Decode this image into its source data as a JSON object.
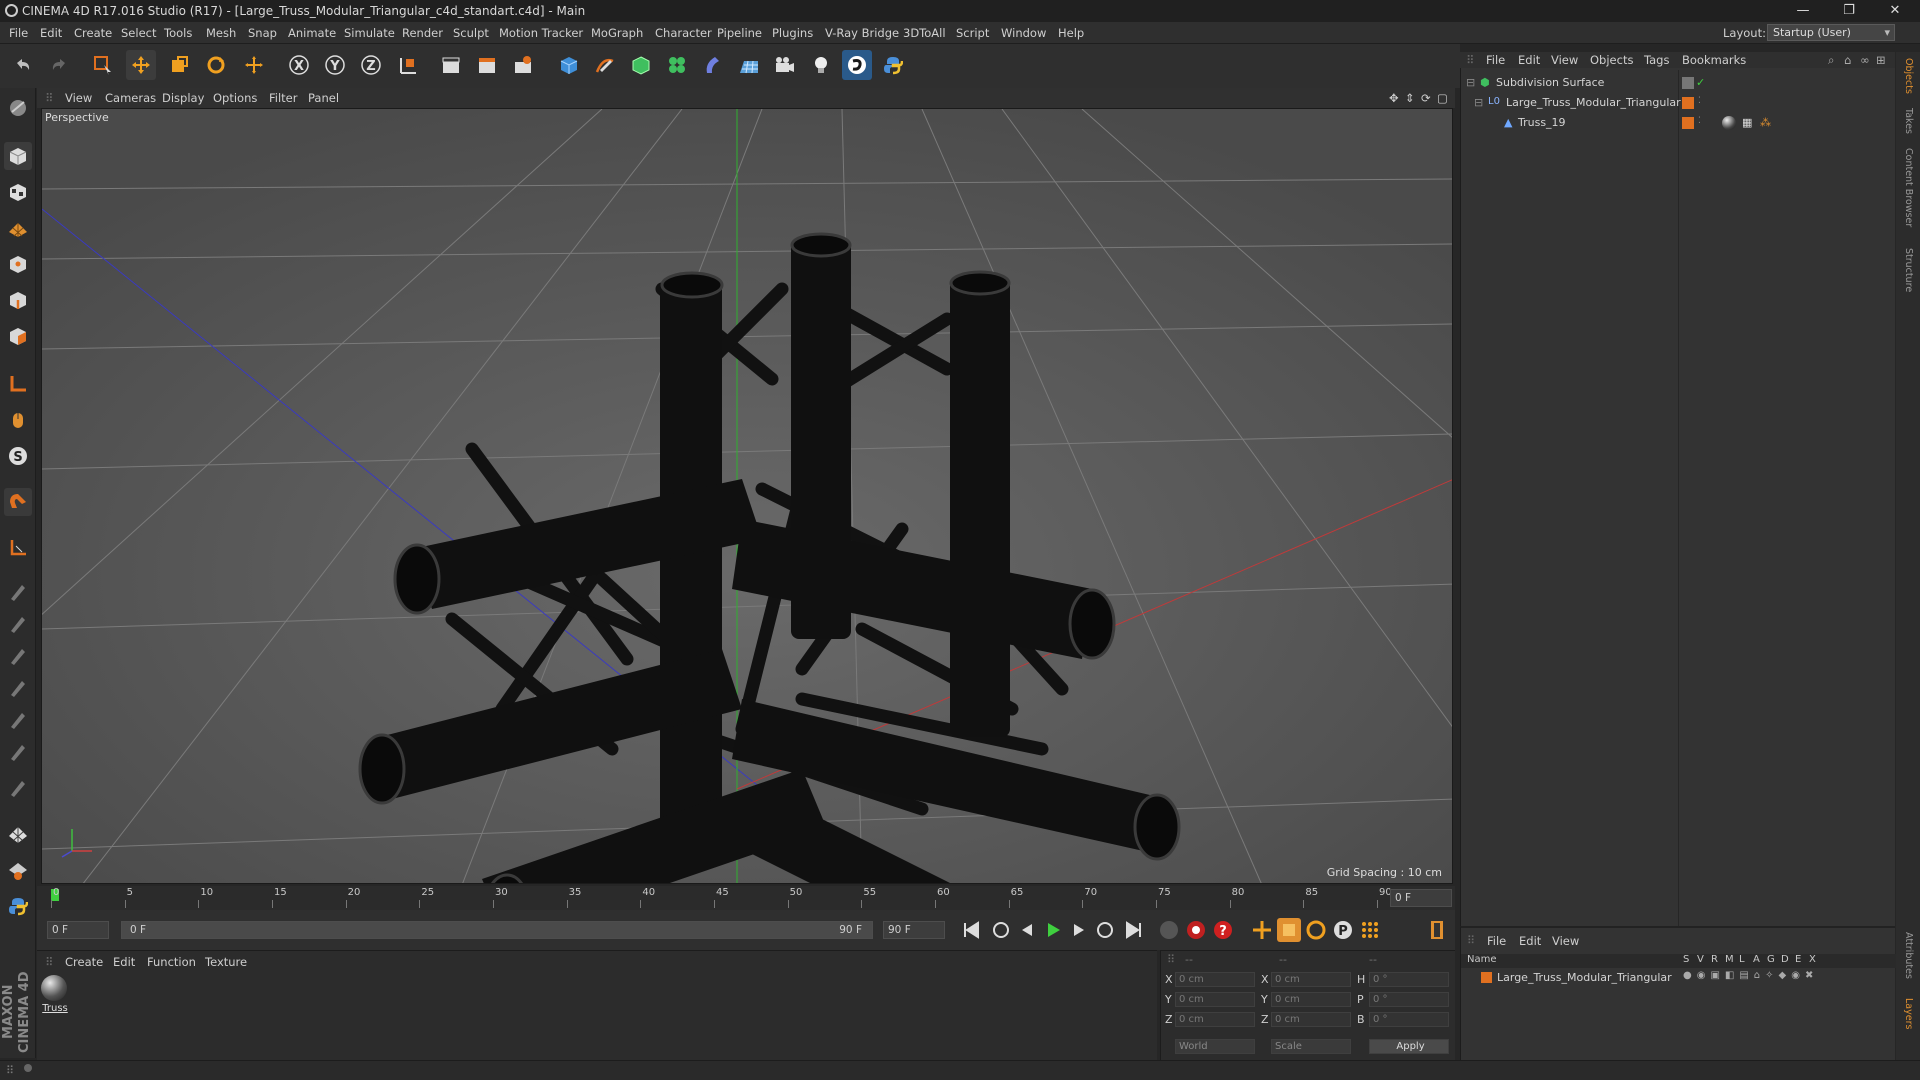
{
  "title_bar": {
    "title": "CINEMA 4D R17.016 Studio (R17) - [Large_Truss_Modular_Triangular_c4d_standart.c4d] - Main",
    "minimize": "—",
    "restore": "❐",
    "close": "✕"
  },
  "menu": {
    "items": [
      "File",
      "Edit",
      "Create",
      "Select",
      "Tools",
      "Mesh",
      "Snap",
      "Animate",
      "Simulate",
      "Render",
      "Sculpt",
      "Motion Tracker",
      "MoGraph",
      "Character",
      "Pipeline",
      "Plugins",
      "V-Ray Bridge",
      "3DToAll",
      "Script",
      "Window",
      "Help"
    ],
    "layout_label": "Layout:",
    "layout_value": "Startup (User)"
  },
  "viewport": {
    "menu": [
      "View",
      "Cameras",
      "Display",
      "Options",
      "Filter",
      "Panel"
    ],
    "label": "Perspective",
    "grid_spacing": "Grid Spacing : 10 cm"
  },
  "timeline": {
    "ticks": [
      "0",
      "5",
      "10",
      "15",
      "20",
      "25",
      "30",
      "35",
      "40",
      "45",
      "50",
      "55",
      "60",
      "65",
      "70",
      "75",
      "80",
      "85",
      "90"
    ],
    "current_frame": "0 F",
    "start_frame": "0 F",
    "range_start": "0 F",
    "range_end": "90 F",
    "end_frame": "90 F"
  },
  "material_panel": {
    "menu": [
      "Create",
      "Edit",
      "Function",
      "Texture"
    ],
    "materials": [
      {
        "name": "Truss"
      }
    ]
  },
  "coordinates": {
    "header": [
      "--",
      "--",
      "--"
    ],
    "rows": [
      {
        "axis": "X",
        "pos": "0 cm",
        "size_axis": "X",
        "size": "0 cm",
        "rot_axis": "H",
        "rot": "0 °"
      },
      {
        "axis": "Y",
        "pos": "0 cm",
        "size_axis": "Y",
        "size": "0 cm",
        "rot_axis": "P",
        "rot": "0 °"
      },
      {
        "axis": "Z",
        "pos": "0 cm",
        "size_axis": "Z",
        "size": "0 cm",
        "rot_axis": "B",
        "rot": "0 °"
      }
    ],
    "space": "World",
    "mode": "Scale",
    "apply": "Apply"
  },
  "object_manager": {
    "menu": [
      "File",
      "Edit",
      "View",
      "Objects",
      "Tags",
      "Bookmarks"
    ],
    "objects": [
      {
        "name": "Subdivision Surface",
        "depth": 0
      },
      {
        "name": "Large_Truss_Modular_Triangular",
        "depth": 1
      },
      {
        "name": "Truss_19",
        "depth": 2
      }
    ]
  },
  "layers": {
    "menu": [
      "File",
      "Edit",
      "View"
    ],
    "columns": [
      "Name",
      "S",
      "V",
      "R",
      "M",
      "L",
      "A",
      "G",
      "D",
      "E",
      "X"
    ],
    "rows": [
      {
        "name": "Large_Truss_Modular_Triangular"
      }
    ]
  },
  "side_tabs": [
    "Objects",
    "Takes",
    "Content Browser",
    "Structure",
    "Attributes",
    "Layers"
  ],
  "brand": {
    "text": "MAXON CINEMA 4D"
  },
  "colors": {
    "accent": "#e07020",
    "active": "#6fa8ff",
    "truss": "#0d0d0d",
    "viewport": "#5b5b5b"
  }
}
